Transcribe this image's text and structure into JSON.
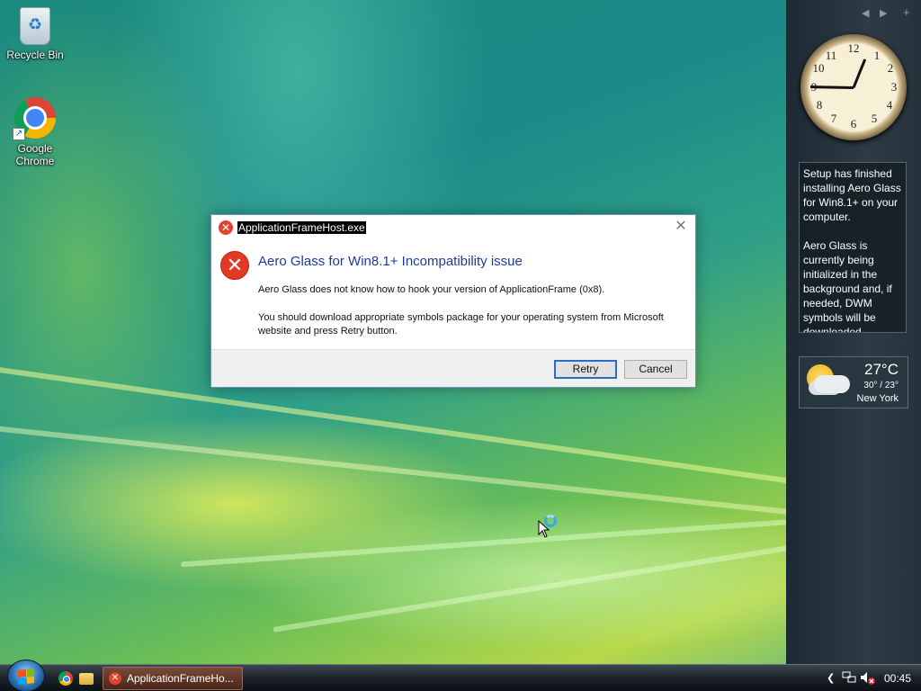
{
  "desktop": {
    "icons": [
      {
        "label": "Recycle Bin",
        "icon": "recycle-bin-icon"
      },
      {
        "label": "Google Chrome",
        "icon": "chrome-icon"
      }
    ]
  },
  "dialog": {
    "title": "ApplicationFrameHost.exe",
    "heading": "Aero Glass for Win8.1+ Incompatibility issue",
    "message1": "Aero Glass does not know how to hook your version of ApplicationFrame (0x8).",
    "message2": "You should download appropriate symbols package for your operating system from Microsoft website and press Retry button.",
    "retry_label": "Retry",
    "cancel_label": "Cancel",
    "close_glyph": "✕",
    "error_glyph": "✕"
  },
  "sidebar": {
    "controls": {
      "prev": "◀",
      "next": "▶",
      "add": "+"
    },
    "clock": {
      "numbers": [
        "12",
        "1",
        "2",
        "3",
        "4",
        "5",
        "6",
        "7",
        "8",
        "9",
        "10",
        "11"
      ],
      "time": "00:45"
    },
    "notes_gadget": {
      "para1": "Setup has finished installing Aero Glass for Win8.1+ on your computer.",
      "para2": "Aero Glass is currently being initialized in the background and, if needed, DWM symbols will be downloaded."
    },
    "weather": {
      "temp": "27°C",
      "range": "30° / 23°",
      "city": "New York"
    }
  },
  "taskbar": {
    "task_label": "ApplicationFrameHo...",
    "tray": {
      "chevron": "❮",
      "clock": "00:45"
    }
  },
  "colors": {
    "error_red": "#e23a25",
    "heading_blue": "#1c3c9a",
    "default_button_border": "#2d6cc4"
  }
}
